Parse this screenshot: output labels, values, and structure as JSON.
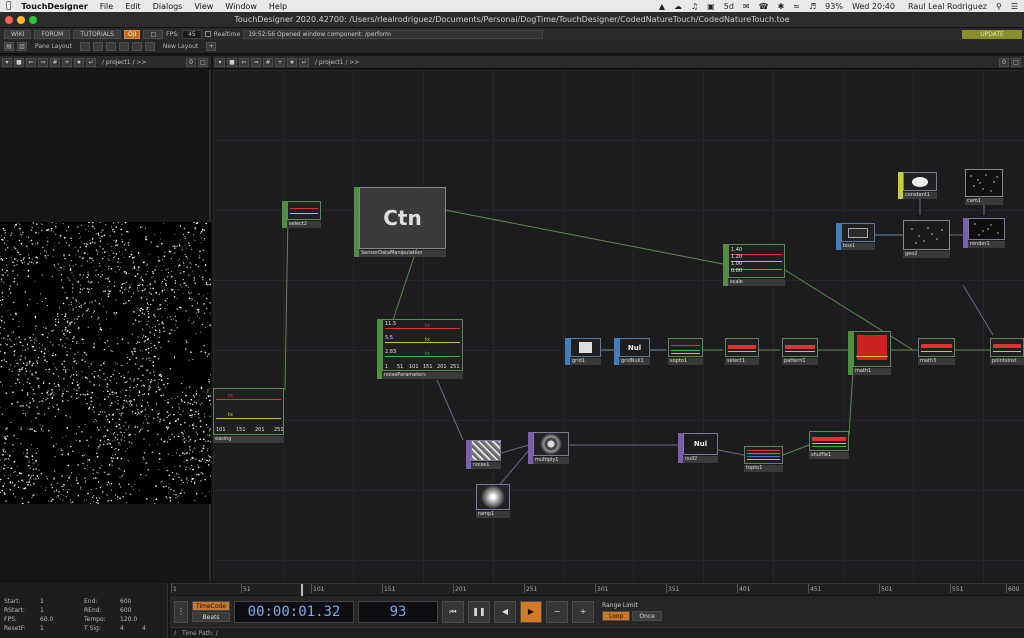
{
  "menubar": {
    "app_name": "TouchDesigner",
    "menus": [
      "File",
      "Edit",
      "Dialogs",
      "View",
      "Window",
      "Help"
    ],
    "battery": "93%",
    "clock": "Wed 20:40",
    "user": "Raul Leal Rodriguez",
    "tray_badge": "5d"
  },
  "window": {
    "title": "TouchDesigner 2020.42700: /Users/rlealrodriguez/Documents/Personal/DogTime/TouchDesigner/CodedNatureTouch/CodedNatureTouch.toe"
  },
  "toolbar": {
    "wiki": "WIKI",
    "forum": "FORUM",
    "tutorials": "TUTORIALS",
    "oi_badge": "O|I",
    "fps_label": "FPS:",
    "fps_value": "45",
    "realtime": "Realtime",
    "message": "19:52:56 Opened window component: /perform",
    "update": "UPDATE"
  },
  "panebar": {
    "pane_layout": "Pane Layout",
    "new_layout": "New Layout"
  },
  "pane_header": {
    "path": "/ project1 / >>",
    "counter_left": "0",
    "counter_right": "0"
  },
  "nodes": {
    "select2": "select2",
    "ctn_title": "Ctn",
    "ctn_label": "SensorDataManipulation",
    "scale": "scale",
    "scale_values": [
      "1.40",
      "1.20",
      "1.00",
      "0.80"
    ],
    "noise_params": "noiseParameters",
    "noise_values": [
      "11.5",
      "5.5",
      "2.83"
    ],
    "noise_axis": [
      "1",
      "51",
      "101",
      "151",
      "201",
      "251"
    ],
    "noise_channels": [
      "tx",
      "tx",
      "tx"
    ],
    "easing": "easing",
    "easing_axis": [
      "101",
      "151",
      "201",
      "251"
    ],
    "easing_channels": [
      "tx",
      "tx"
    ],
    "grid1": "grid1",
    "null_title": "Nul",
    "grid_null": "gridNull1",
    "sopto1": "sopto1",
    "select1": "select1",
    "pattern": "pattern1",
    "math": "math1",
    "math3": "math3",
    "points_instance": "pointsInst",
    "box1": "box1",
    "geo2": "geo2",
    "render1": "render1",
    "constant1": "constant1",
    "cam1": "cam1",
    "noise1": "noise1",
    "multiply": "multiply1",
    "null2": "null2",
    "topto1": "topto1",
    "shuffle": "shuffle1",
    "ramp": "ramp1"
  },
  "timeline": {
    "ticks": [
      "1",
      "51",
      "101",
      "151",
      "201",
      "251",
      "301",
      "351",
      "401",
      "451",
      "501",
      "551",
      "600"
    ],
    "info": {
      "start_label": "Start:",
      "start": "1",
      "end_label": "End:",
      "end": "600",
      "rstart_label": "RStart:",
      "rstart": "1",
      "rend_label": "REnd:",
      "rend": "600",
      "fps_label": "FPS:",
      "fps": "60.0",
      "tempo_label": "Tempo:",
      "tempo": "120.0",
      "resetf_label": "ResetF:",
      "resetf": "1",
      "tsig_label": "T Sig:",
      "tsig_a": "4",
      "tsig_b": "4"
    },
    "timecode_btn": "TimeCode",
    "beats_btn": "Beats",
    "timecode": "00:00:01.32",
    "frame": "93",
    "range_limit": "Range Limit",
    "loop": "Loop",
    "once": "Once",
    "time_path": "Time Path: /"
  },
  "colors": {
    "chop": "#4f8f3f",
    "top": "#7a5fae",
    "sop": "#3f7fbf",
    "active_orange": "#c7782a",
    "timecode_text": "#7fa8e6"
  }
}
